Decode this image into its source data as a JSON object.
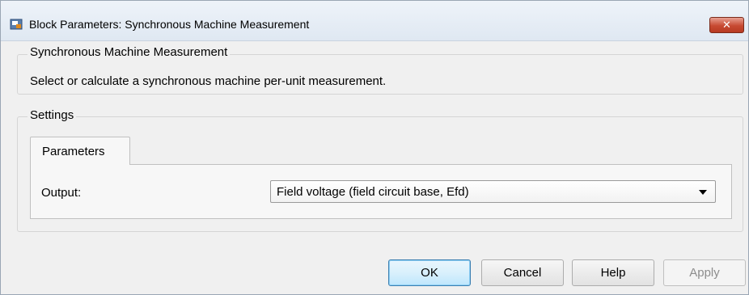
{
  "window": {
    "title": "Block Parameters: Synchronous Machine Measurement",
    "close_label": "✕"
  },
  "block_group": {
    "legend": "Synchronous Machine Measurement",
    "description": "Select or calculate a synchronous machine per-unit measurement."
  },
  "settings_group": {
    "legend": "Settings",
    "tabs": [
      {
        "label": "Parameters"
      }
    ],
    "output": {
      "label": "Output:",
      "value": "Field voltage (field circuit base, Efd)"
    }
  },
  "buttons": {
    "ok": "OK",
    "cancel": "Cancel",
    "help": "Help",
    "apply": "Apply"
  },
  "icons": {
    "app": "simulink-block-icon",
    "close": "close-icon",
    "dropdown": "chevron-down-icon"
  },
  "colors": {
    "close_button": "#c74a32",
    "ok_border": "#3c7fb1",
    "dialog_bg": "#f0f0f0"
  }
}
